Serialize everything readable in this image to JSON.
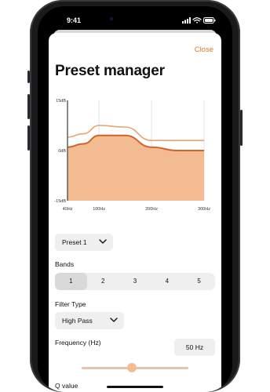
{
  "status": {
    "time": "9:41"
  },
  "header": {
    "close_label": "Close",
    "title": "Preset manager"
  },
  "chart_data": {
    "type": "area",
    "title": "",
    "y_ticks": [
      "15dB",
      "0dB",
      "-15dB"
    ],
    "x_ticks": [
      "40Hz",
      "100Hz",
      "200Hz",
      "300Hz"
    ],
    "ylim": [
      -15,
      15
    ],
    "xlim": [
      40,
      300
    ],
    "grid": true,
    "series": [
      {
        "curve": "filled",
        "color": "#f2bb91",
        "line_color": "#d0652a",
        "x": [
          40,
          70,
          100,
          150,
          200,
          250,
          300
        ],
        "y": [
          1,
          2,
          4.5,
          4.5,
          1,
          0,
          0
        ]
      },
      {
        "curve": "outline",
        "color": "#e8a36e",
        "x": [
          40,
          70,
          100,
          150,
          200,
          250,
          300
        ],
        "y": [
          4,
          5,
          7.5,
          7,
          3,
          3,
          3
        ]
      }
    ]
  },
  "preset": {
    "label": "Preset 1"
  },
  "bands": {
    "label": "Bands",
    "options": [
      "1",
      "2",
      "3",
      "4",
      "5"
    ],
    "selected": "1"
  },
  "filter": {
    "label": "Filter Type",
    "value": "High Pass"
  },
  "frequency": {
    "label": "Frequency (Hz)",
    "value": "50 Hz",
    "slider_fraction": 0.47
  },
  "q": {
    "label": "Q value"
  },
  "colors": {
    "accent": "#e07b2c",
    "fill": "#f2bb91",
    "line": "#d0652a"
  }
}
